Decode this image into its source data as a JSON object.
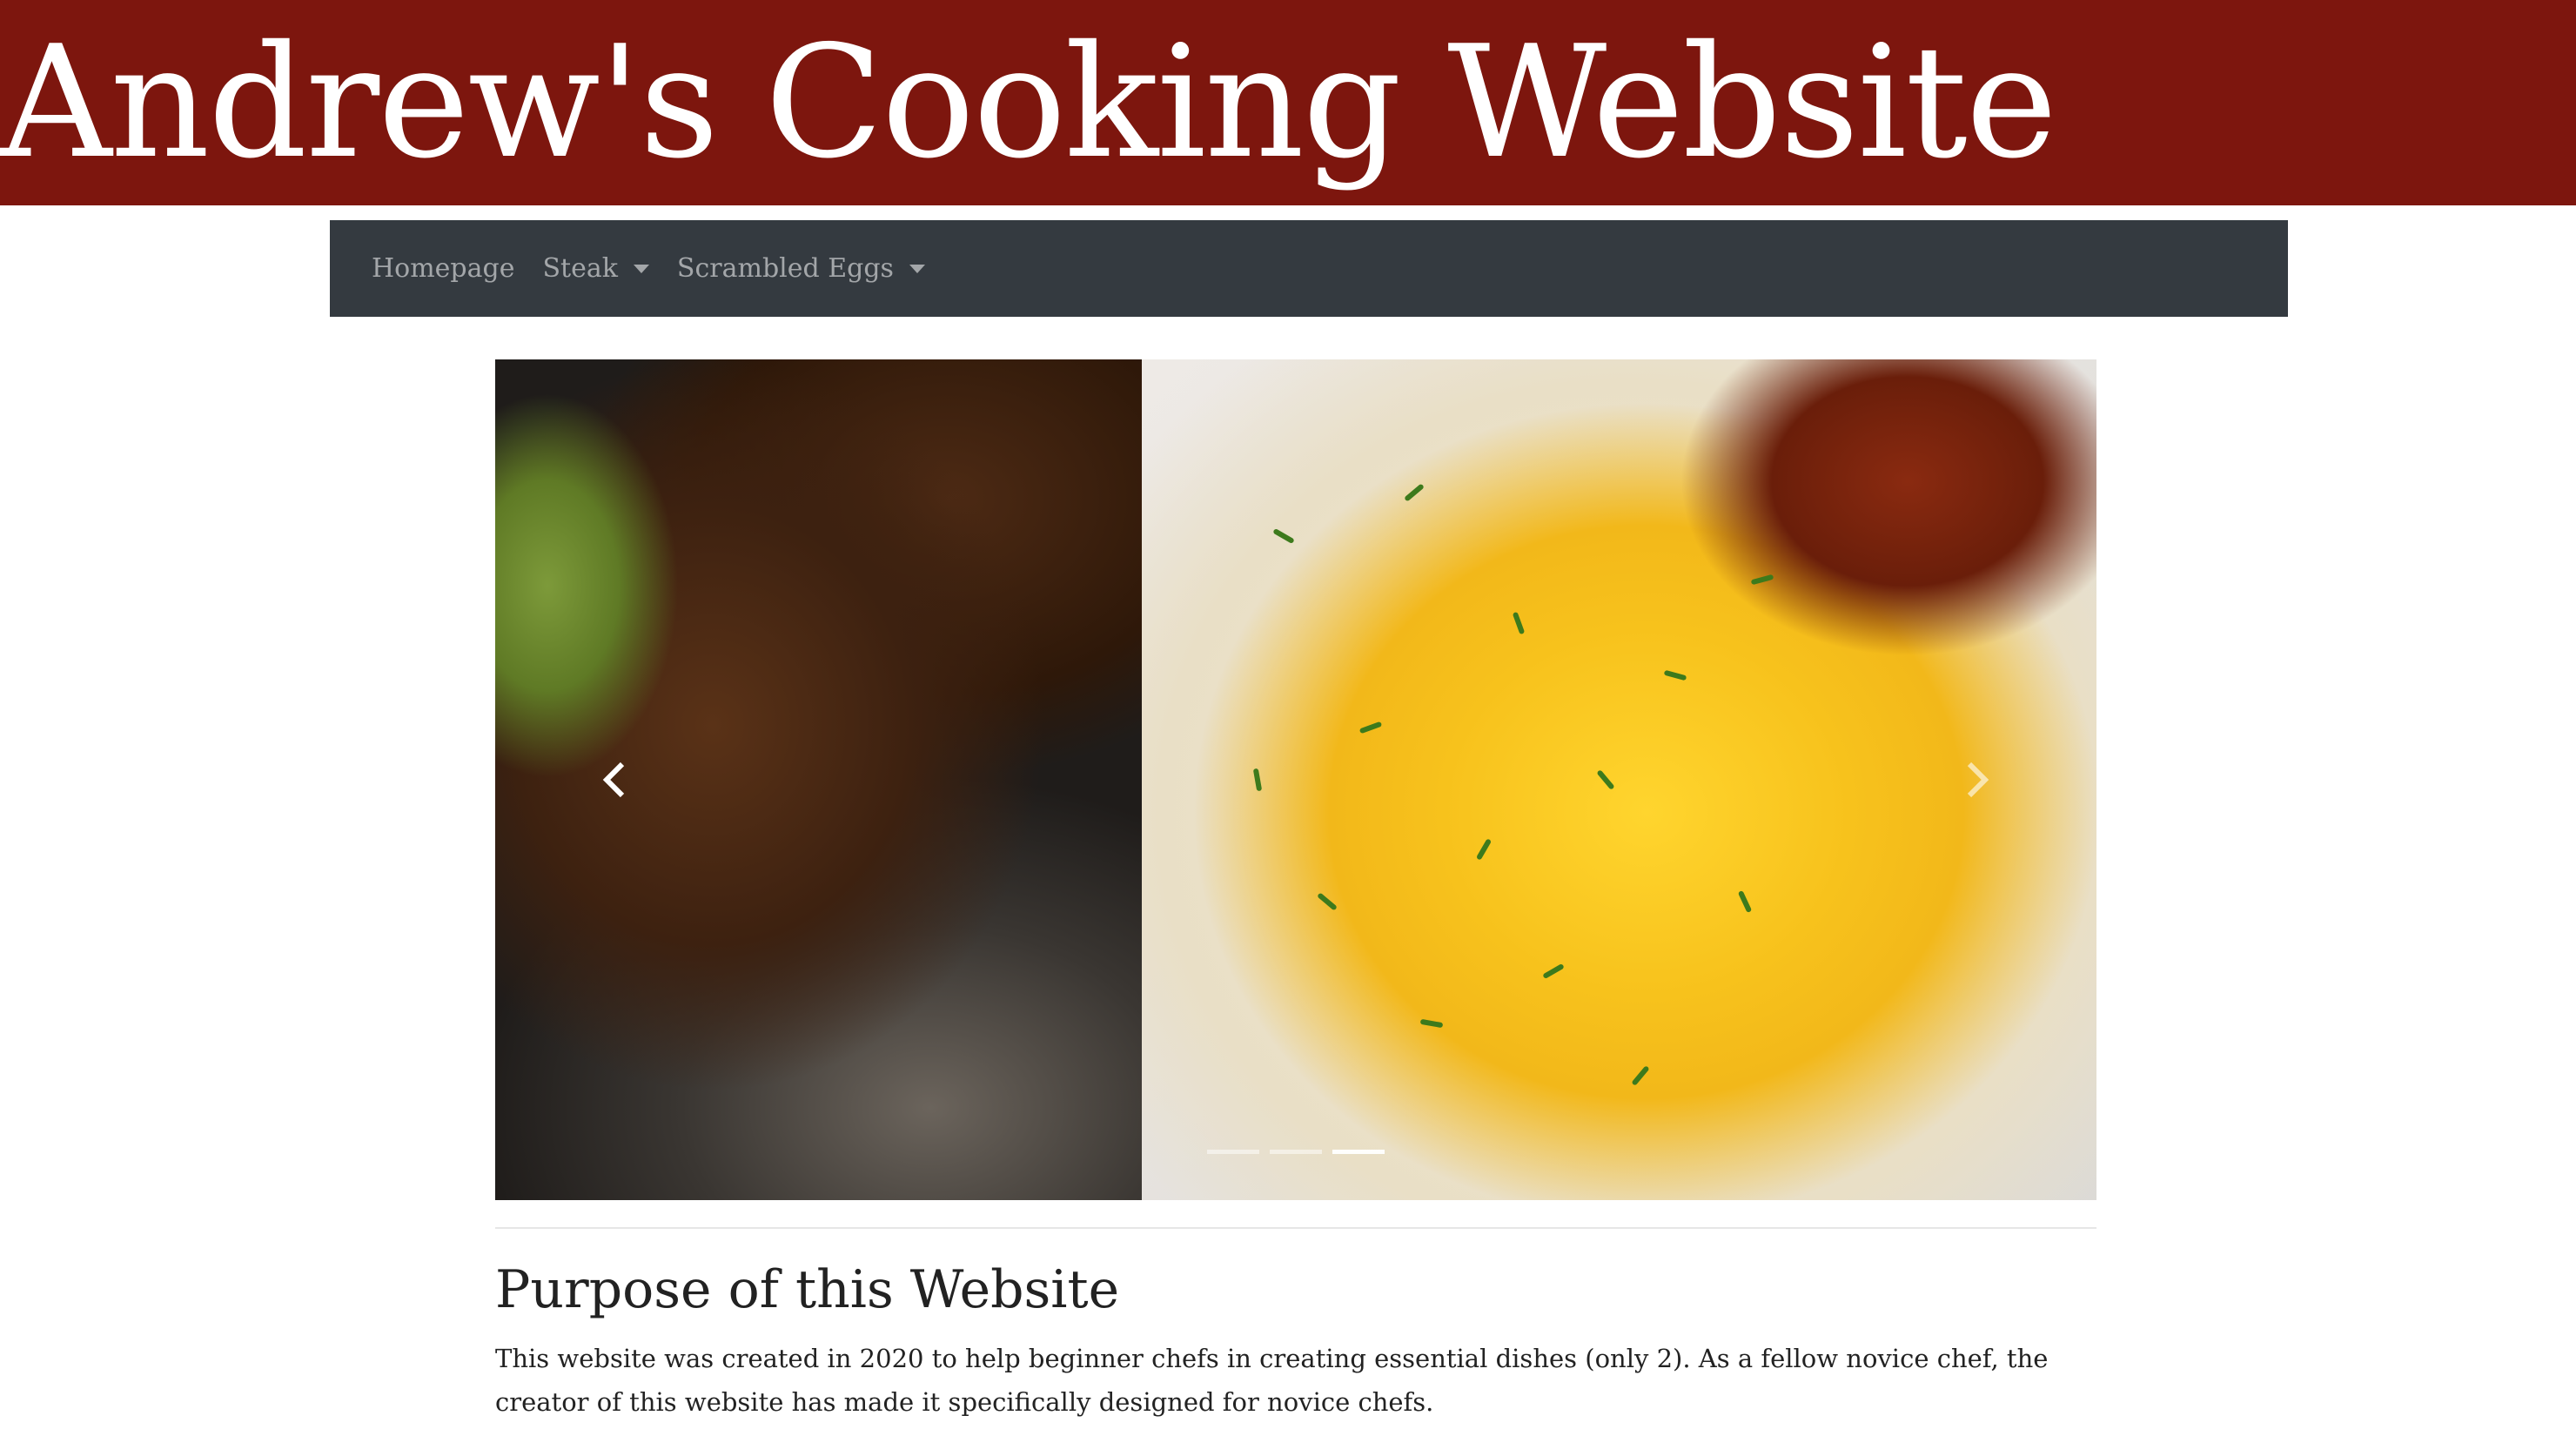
{
  "site": {
    "title": "Andrew's Cooking Website",
    "banner_color": "#7d160e"
  },
  "navbar": {
    "background": "#343a40",
    "items": [
      {
        "label": "Homepage",
        "dropdown": false
      },
      {
        "label": "Steak",
        "dropdown": true
      },
      {
        "label": "Scrambled Eggs",
        "dropdown": true
      }
    ]
  },
  "carousel": {
    "slides": [
      {
        "image": "steak-photo"
      },
      {
        "image": "scrambled-eggs-photo"
      }
    ],
    "indicator_count": 3,
    "active_indicator": 2,
    "prev_icon": "chevron-left-icon",
    "next_icon": "chevron-right-icon"
  },
  "purpose": {
    "heading": "Purpose of this Website",
    "text": "This website was created in 2020 to help beginner chefs in creating essential dishes (only 2). As a fellow novice chef, the creator of this website has made it specifically designed for novice chefs."
  }
}
